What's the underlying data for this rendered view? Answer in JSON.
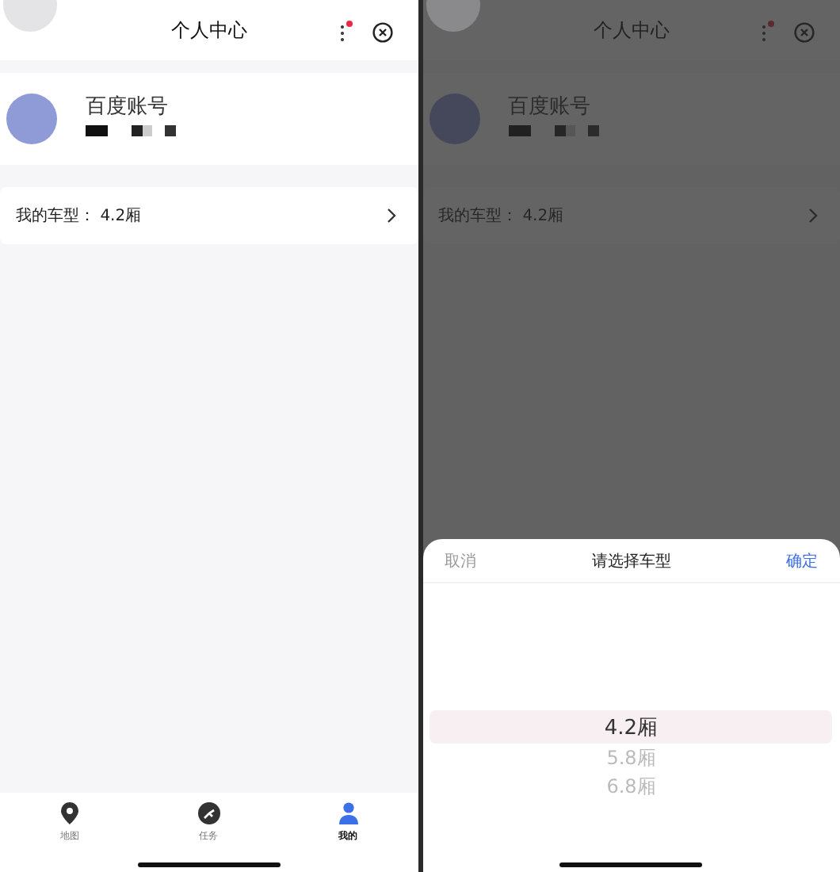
{
  "screens": [
    {
      "dimmed": false,
      "header": {
        "title": "个人中心",
        "menu_badge": true
      },
      "account": {
        "name": "百度账号"
      },
      "vehicle_row": {
        "label": "我的车型：",
        "value": "4.2厢"
      },
      "tab_bar": [
        {
          "label": "地图",
          "selected": false
        },
        {
          "label": "任务",
          "selected": false
        },
        {
          "label": "我的",
          "selected": true
        }
      ]
    },
    {
      "dimmed": true,
      "header": {
        "title": "个人中心",
        "menu_badge": true
      },
      "account": {
        "name": "百度账号"
      },
      "vehicle_row": {
        "label": "我的车型：",
        "value": "4.2厢"
      },
      "picker": {
        "cancel": "取消",
        "title": "请选择车型",
        "confirm": "确定",
        "options": [
          {
            "label": "4.2厢",
            "selected": true
          },
          {
            "label": "5.8厢",
            "selected": false
          },
          {
            "label": "6.8厢",
            "selected": false
          }
        ]
      }
    }
  ]
}
